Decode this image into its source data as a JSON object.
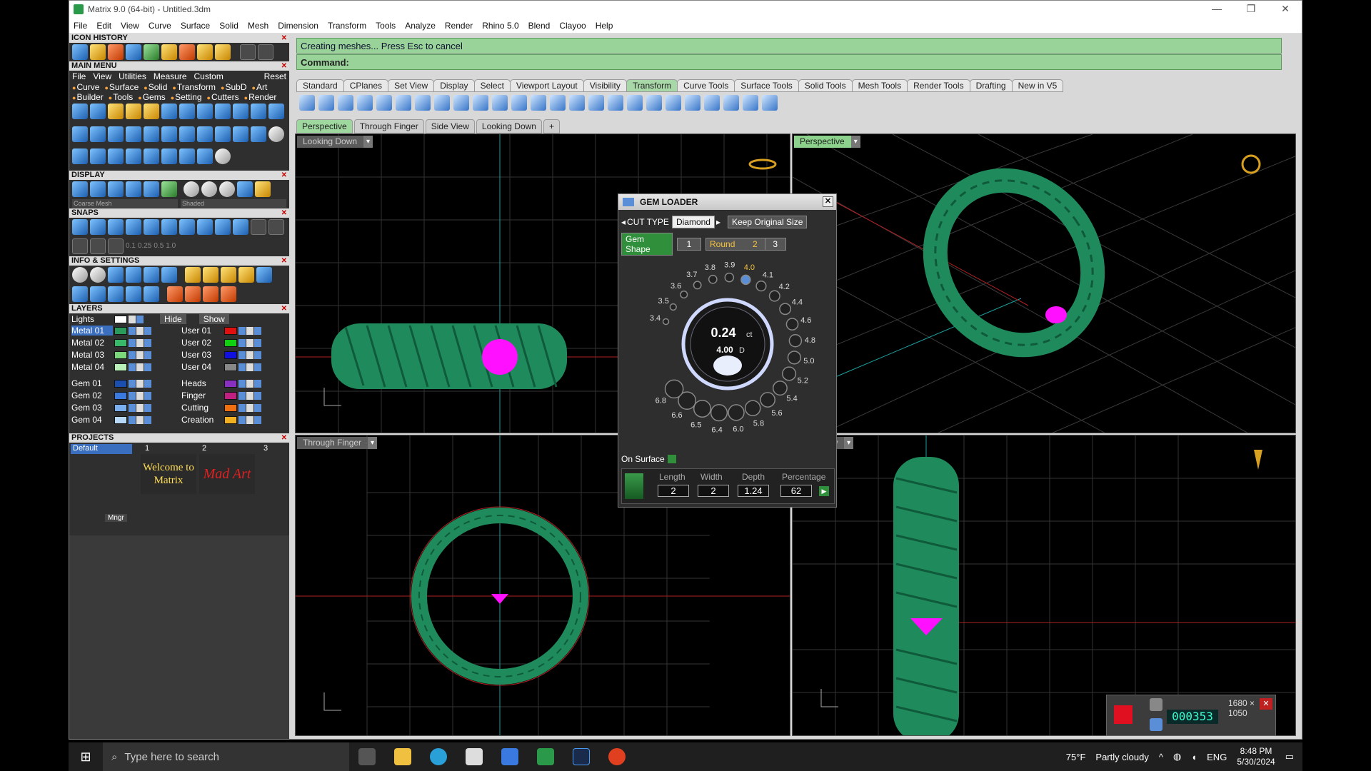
{
  "window": {
    "title": "Matrix 9.0 (64-bit) - Untitled.3dm"
  },
  "menubar": [
    "File",
    "Edit",
    "View",
    "Curve",
    "Surface",
    "Solid",
    "Mesh",
    "Dimension",
    "Transform",
    "Tools",
    "Analyze",
    "Render",
    "Rhino 5.0",
    "Blend",
    "Clayoo",
    "Help"
  ],
  "sections": {
    "icon_history": "ICON HISTORY",
    "main_menu": "MAIN MENU",
    "display": "DISPLAY",
    "snaps": "SNAPS",
    "info_settings": "INFO & SETTINGS",
    "layers": "LAYERS",
    "projects": "PROJECTS"
  },
  "main_menu": {
    "items": [
      "File",
      "View",
      "Utilities",
      "Measure",
      "Custom"
    ],
    "reset": "Reset",
    "cat_row1": [
      "Curve",
      "Surface",
      "Solid",
      "Transform",
      "SubD",
      "Art"
    ],
    "cat_row2": [
      "Builder",
      "Tools",
      "Gems",
      "Setting",
      "Cutters",
      "Render"
    ]
  },
  "display": {
    "mesh": "Coarse Mesh",
    "mode": "Shaded"
  },
  "snaps": {
    "values": [
      "0.1",
      "0.25",
      "0.5",
      "1.0"
    ]
  },
  "layers": {
    "lights": "Lights",
    "hide": "Hide",
    "show": "Show",
    "left": [
      {
        "name": "Metal 01",
        "color": "#2a9a5a"
      },
      {
        "name": "Metal 02",
        "color": "#3ab86a"
      },
      {
        "name": "Metal 03",
        "color": "#7ad87a"
      },
      {
        "name": "Metal 04",
        "color": "#b8f0b8"
      },
      {
        "name": "Gem 01",
        "color": "#1a4fb0"
      },
      {
        "name": "Gem 02",
        "color": "#3a7ae0"
      },
      {
        "name": "Gem 03",
        "color": "#7ab0f0"
      },
      {
        "name": "Gem 04",
        "color": "#b8d8f8"
      }
    ],
    "right": [
      {
        "name": "User 01",
        "color": "#e01010"
      },
      {
        "name": "User 02",
        "color": "#10d010"
      },
      {
        "name": "User 03",
        "color": "#1010e0"
      },
      {
        "name": "User 04",
        "color": "#888888"
      },
      {
        "name": "Heads",
        "color": "#8a30c0"
      },
      {
        "name": "Finger",
        "color": "#c02080"
      },
      {
        "name": "Cutting",
        "color": "#f07010"
      },
      {
        "name": "Creation",
        "color": "#f0b020"
      }
    ]
  },
  "projects": {
    "default": "Default",
    "slot1": "1",
    "slot2": "2",
    "slot3": "3",
    "thumb1": "Welcome to Matrix",
    "thumb2": "Mad Art",
    "mngr": "Mngr"
  },
  "status": {
    "message": "Creating meshes... Press Esc to cancel",
    "command": "Command:"
  },
  "toolbar_tabs": [
    {
      "label": "Standard"
    },
    {
      "label": "CPlanes"
    },
    {
      "label": "Set View"
    },
    {
      "label": "Display"
    },
    {
      "label": "Select"
    },
    {
      "label": "Viewport Layout"
    },
    {
      "label": "Visibility"
    },
    {
      "label": "Transform",
      "active": true
    },
    {
      "label": "Curve Tools"
    },
    {
      "label": "Surface Tools"
    },
    {
      "label": "Solid Tools"
    },
    {
      "label": "Mesh Tools"
    },
    {
      "label": "Render Tools"
    },
    {
      "label": "Drafting"
    },
    {
      "label": "New in V5"
    }
  ],
  "view_tabs": [
    "Perspective",
    "Through Finger",
    "Side View",
    "Looking Down",
    "+"
  ],
  "viewports": {
    "top_left": "Looking Down",
    "top_right": "Perspective",
    "bottom_left": "Through Finger",
    "bottom_right": "Side View"
  },
  "gem_loader": {
    "title": "GEM LOADER",
    "cut_type_label": "CUT TYPE",
    "cut_type": "Diamond",
    "keep_original": "Keep Original Size",
    "gem_shape": "Gem Shape",
    "tab1": "1",
    "shape": "Round",
    "tab2": "2",
    "tab3": "3",
    "sizes": [
      "3.4",
      "3.5",
      "3.6",
      "3.7",
      "3.8",
      "3.9",
      "4.0",
      "4.1",
      "4.2",
      "4.4",
      "4.6",
      "4.8",
      "5.0",
      "5.2",
      "5.4",
      "5.6",
      "5.8",
      "6.0",
      "6.4",
      "6.5",
      "6.6",
      "6.8"
    ],
    "carat": "0.24",
    "carat_unit": "ct",
    "diameter": "4.00",
    "diameter_unit": "D",
    "on_surface": "On Surface",
    "headers": {
      "length": "Length",
      "width": "Width",
      "depth": "Depth",
      "percentage": "Percentage"
    },
    "values": {
      "length": "2",
      "width": "2",
      "depth": "1.24",
      "percentage": "62"
    }
  },
  "recorder": {
    "resolution": "1680 × 1050",
    "counter": "000353"
  },
  "taskbar": {
    "search_placeholder": "Type here to search",
    "temp": "75°F",
    "weather": "Partly cloudy",
    "lang": "ENG",
    "time": "8:48 PM",
    "date": "5/30/2024"
  },
  "colors": {
    "ring": "#1f8a5c",
    "gem": "#ff10ff",
    "accent": "#99d399"
  }
}
